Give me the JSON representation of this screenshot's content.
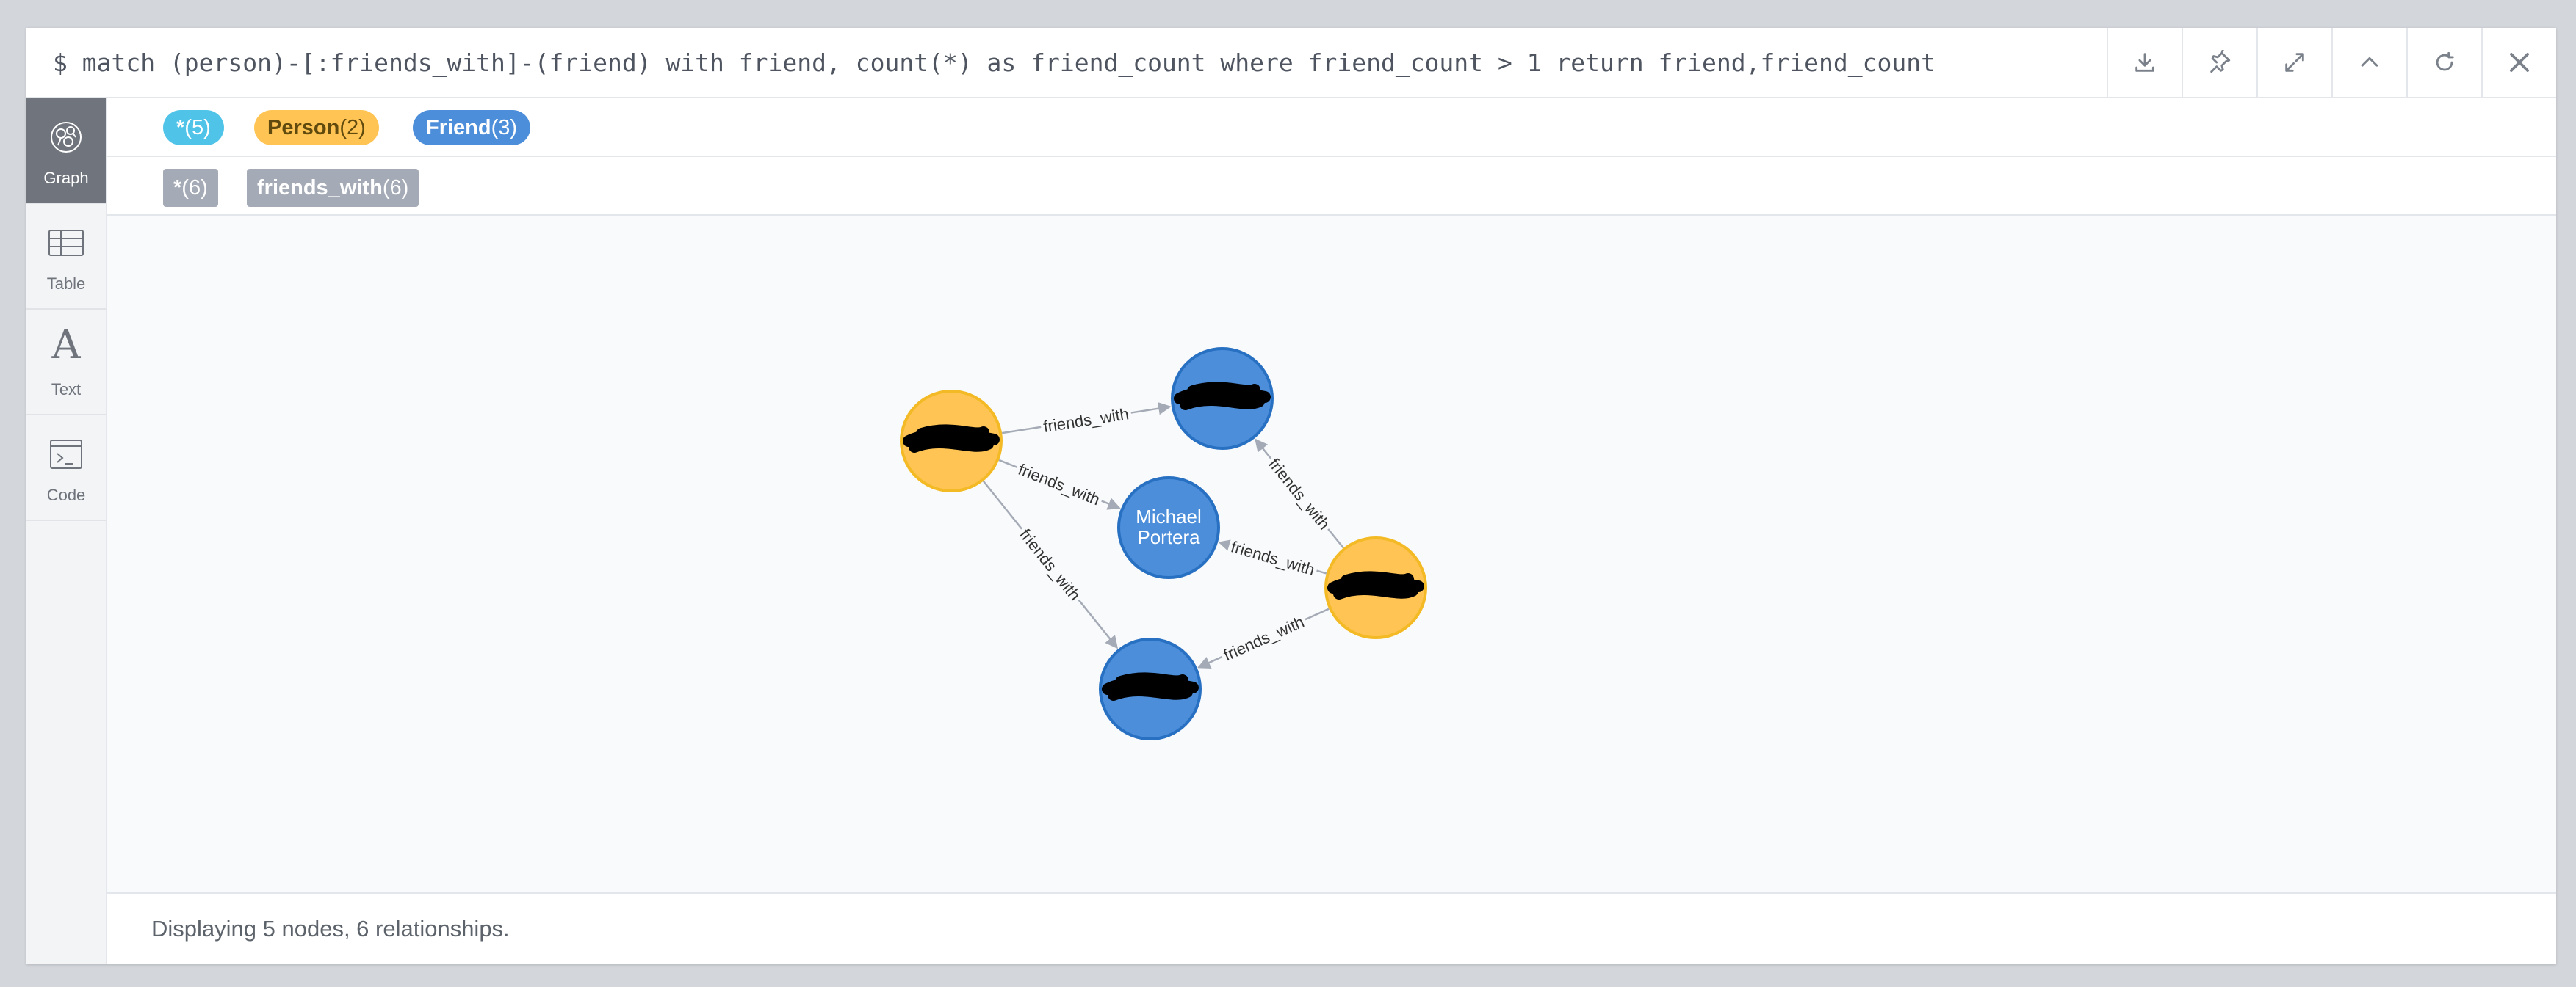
{
  "query": {
    "text": "$ match (person)-[:friends_with]-(friend) with friend, count(*) as friend_count where friend_count > 1 return friend,friend_count"
  },
  "toolbar": {
    "buttons": [
      {
        "icon": "download-icon"
      },
      {
        "icon": "pin-icon"
      },
      {
        "icon": "expand-icon"
      },
      {
        "icon": "collapse-up-icon"
      },
      {
        "icon": "rerun-icon"
      },
      {
        "icon": "close-icon"
      }
    ]
  },
  "sidebar": {
    "items": [
      {
        "label": "Graph",
        "icon": "graph-icon",
        "active": true
      },
      {
        "label": "Table",
        "icon": "table-icon",
        "active": false
      },
      {
        "label": "Text",
        "icon": "text-icon",
        "active": false
      },
      {
        "label": "Code",
        "icon": "code-icon",
        "active": false
      }
    ]
  },
  "legend": {
    "node_labels": [
      {
        "name": "*",
        "count": "(5)",
        "color": "#4fc4e8"
      },
      {
        "name": "Person",
        "count": "(2)",
        "color": "#ffc454"
      },
      {
        "name": "Friend",
        "count": "(3)",
        "color": "#4c8eda"
      }
    ],
    "relationship_types": [
      {
        "name": "*",
        "count": "(6)",
        "color": "#a5abb6"
      },
      {
        "name": "friends_with",
        "count": "(6)",
        "color": "#a5abb6"
      }
    ]
  },
  "graph": {
    "nodes": [
      {
        "id": "p1",
        "label": "Person",
        "caption": ""
      },
      {
        "id": "p2",
        "label": "Person",
        "caption": ""
      },
      {
        "id": "f1",
        "label": "Friend",
        "caption": ""
      },
      {
        "id": "f2",
        "label": "Friend",
        "caption_lines": [
          "Michael",
          "Portera"
        ]
      },
      {
        "id": "f3",
        "label": "Friend",
        "caption": ""
      }
    ],
    "relationships": [
      {
        "from": "p1",
        "to": "f1",
        "type": "friends_with"
      },
      {
        "from": "p1",
        "to": "f2",
        "type": "friends_with"
      },
      {
        "from": "p1",
        "to": "f3",
        "type": "friends_with"
      },
      {
        "from": "p2",
        "to": "f1",
        "type": "friends_with"
      },
      {
        "from": "p2",
        "to": "f2",
        "type": "friends_with"
      },
      {
        "from": "p2",
        "to": "f3",
        "type": "friends_with"
      }
    ],
    "colors": {
      "person_fill": "#ffc454",
      "person_stroke": "#f3ba25",
      "friend_fill": "#4c8eda",
      "friend_stroke": "#2870c2",
      "edge": "#a5abb6",
      "redaction": "#000000"
    }
  },
  "status": {
    "text": "Displaying 5 nodes, 6 relationships."
  }
}
